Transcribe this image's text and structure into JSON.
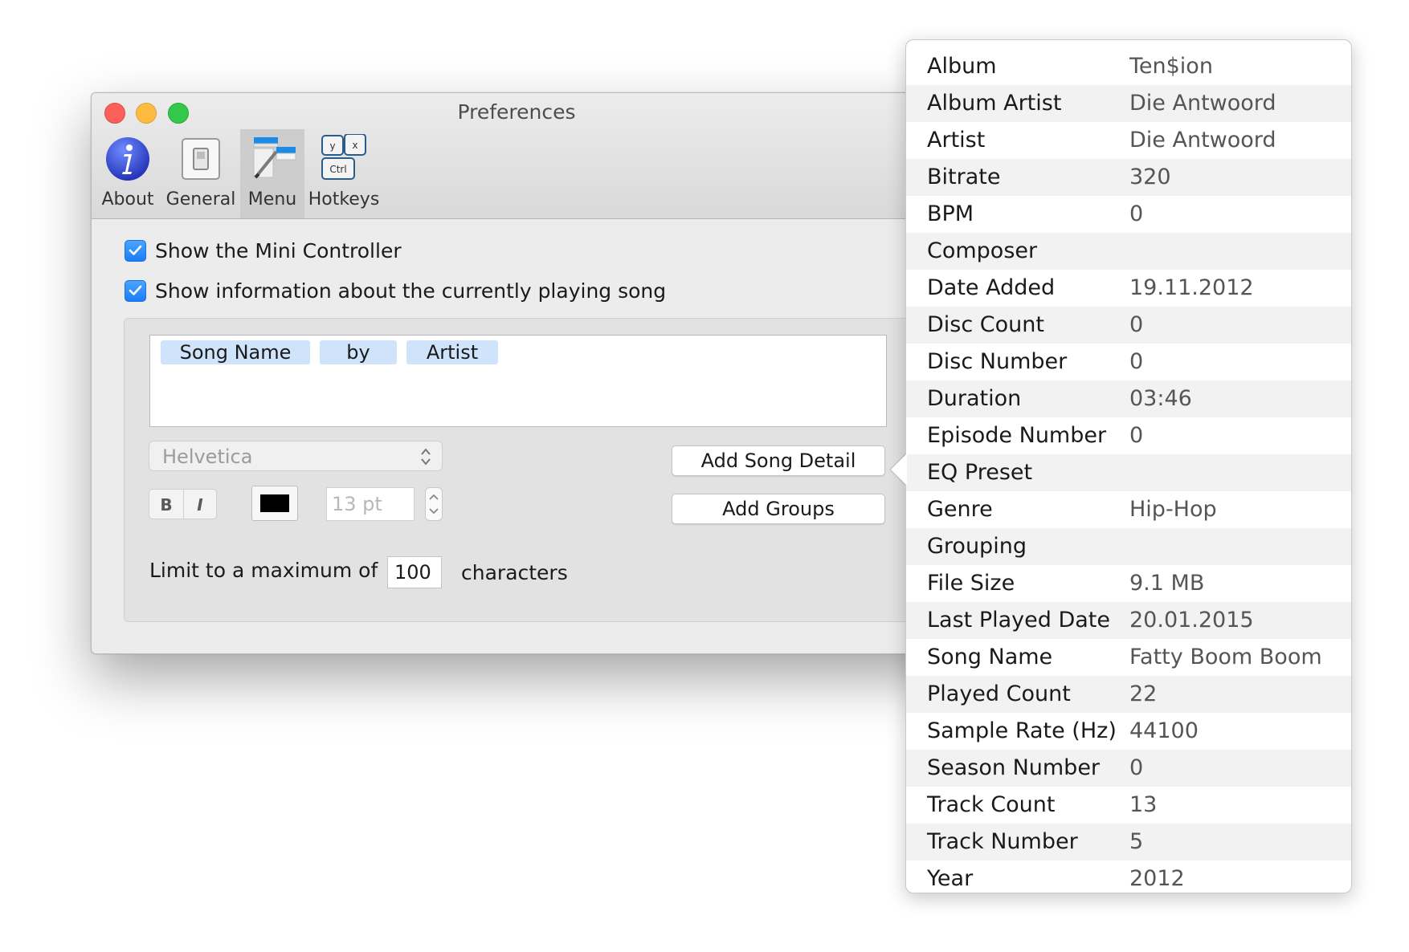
{
  "window": {
    "title": "Preferences",
    "toolbar": [
      {
        "label": "About",
        "icon": "info-icon"
      },
      {
        "label": "General",
        "icon": "switch-icon"
      },
      {
        "label": "Menu",
        "icon": "menu-icon",
        "selected": true
      },
      {
        "label": "Hotkeys",
        "icon": "keyboard-icon"
      }
    ],
    "hotkey_keys": [
      "y",
      "x",
      "Ctrl"
    ]
  },
  "options": {
    "show_mini_controller": {
      "label": "Show the Mini Controller",
      "checked": true
    },
    "show_song_info": {
      "label": "Show information about the currently playing song",
      "checked": true
    }
  },
  "format": {
    "tokens": [
      "Song Name",
      "by",
      "Artist"
    ],
    "font": "Helvetica",
    "bold_label": "B",
    "italic_label": "I",
    "color": "#000000",
    "size_placeholder": "13 pt",
    "add_song_detail": "Add Song Detail",
    "add_groups": "Add Groups",
    "limit_prefix": "Limit to a maximum of",
    "limit_value": "100",
    "limit_suffix": "characters"
  },
  "colors": {
    "accent": "#1a7df4",
    "token_bg": "#cfe3fb",
    "close": "#fc605b",
    "minimize": "#fdbc40",
    "maximize": "#34c84a"
  },
  "song_details": [
    {
      "key": "Album",
      "value": "Ten$ion"
    },
    {
      "key": "Album Artist",
      "value": "Die Antwoord"
    },
    {
      "key": "Artist",
      "value": "Die Antwoord"
    },
    {
      "key": "Bitrate",
      "value": "320"
    },
    {
      "key": "BPM",
      "value": "0"
    },
    {
      "key": "Composer",
      "value": ""
    },
    {
      "key": "Date Added",
      "value": "19.11.2012"
    },
    {
      "key": "Disc Count",
      "value": "0"
    },
    {
      "key": "Disc Number",
      "value": "0"
    },
    {
      "key": "Duration",
      "value": "03:46"
    },
    {
      "key": "Episode Number",
      "value": "0"
    },
    {
      "key": "EQ Preset",
      "value": ""
    },
    {
      "key": "Genre",
      "value": "Hip-Hop"
    },
    {
      "key": "Grouping",
      "value": ""
    },
    {
      "key": "File Size",
      "value": "9.1 MB"
    },
    {
      "key": "Last Played Date",
      "value": "20.01.2015"
    },
    {
      "key": "Song Name",
      "value": "Fatty Boom Boom"
    },
    {
      "key": "Played Count",
      "value": "22"
    },
    {
      "key": "Sample Rate (Hz)",
      "value": "44100"
    },
    {
      "key": "Season Number",
      "value": "0"
    },
    {
      "key": "Track Count",
      "value": "13"
    },
    {
      "key": "Track Number",
      "value": "5"
    },
    {
      "key": "Year",
      "value": "2012"
    }
  ]
}
